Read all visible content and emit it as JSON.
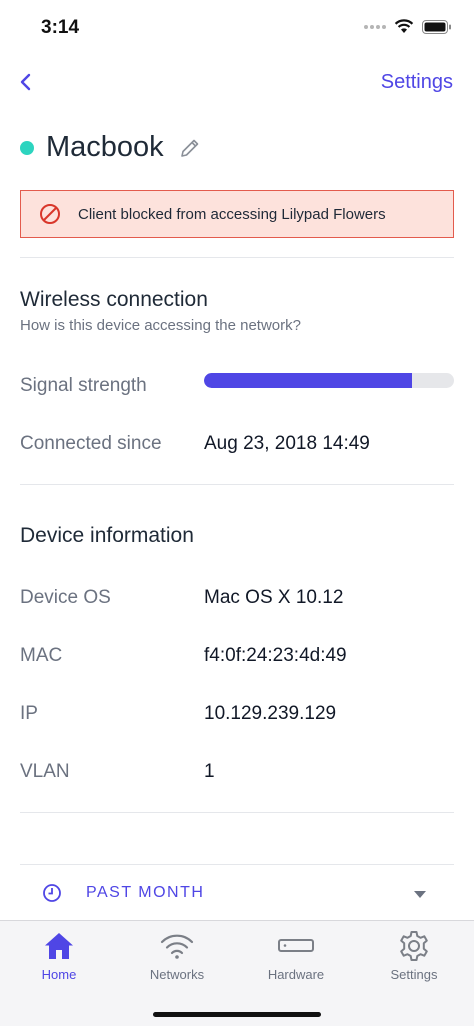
{
  "status_bar": {
    "time": "3:14"
  },
  "nav": {
    "back_icon": "chevron-left-icon",
    "settings_label": "Settings"
  },
  "device": {
    "name": "Macbook",
    "status_color": "#2dd4bf"
  },
  "alert": {
    "text": "Client blocked from accessing Lilypad Flowers",
    "icon": "blocked-icon"
  },
  "wireless": {
    "title": "Wireless connection",
    "subtitle": "How is this device accessing the network?",
    "signal_label": "Signal strength",
    "signal_level": 0.83,
    "connected_label": "Connected since",
    "connected_value": "Aug 23, 2018 14:49"
  },
  "device_info": {
    "title": "Device information",
    "rows": [
      {
        "label": "Device OS",
        "value": "Mac OS X 10.12"
      },
      {
        "label": "MAC",
        "value": "f4:0f:24:23:4d:49"
      },
      {
        "label": "IP",
        "value": "10.129.239.129"
      },
      {
        "label": "VLAN",
        "value": "1"
      }
    ]
  },
  "period": {
    "label": "PAST MONTH"
  },
  "tabbar": {
    "tabs": [
      {
        "label": "Home",
        "icon": "home-icon",
        "active": true
      },
      {
        "label": "Networks",
        "icon": "wifi-icon",
        "active": false
      },
      {
        "label": "Hardware",
        "icon": "hardware-icon",
        "active": false
      },
      {
        "label": "Settings",
        "icon": "gear-icon",
        "active": false
      }
    ]
  },
  "colors": {
    "accent": "#4f46e5",
    "alert_bg": "#fde2dc",
    "alert_border": "#e35b4d"
  }
}
